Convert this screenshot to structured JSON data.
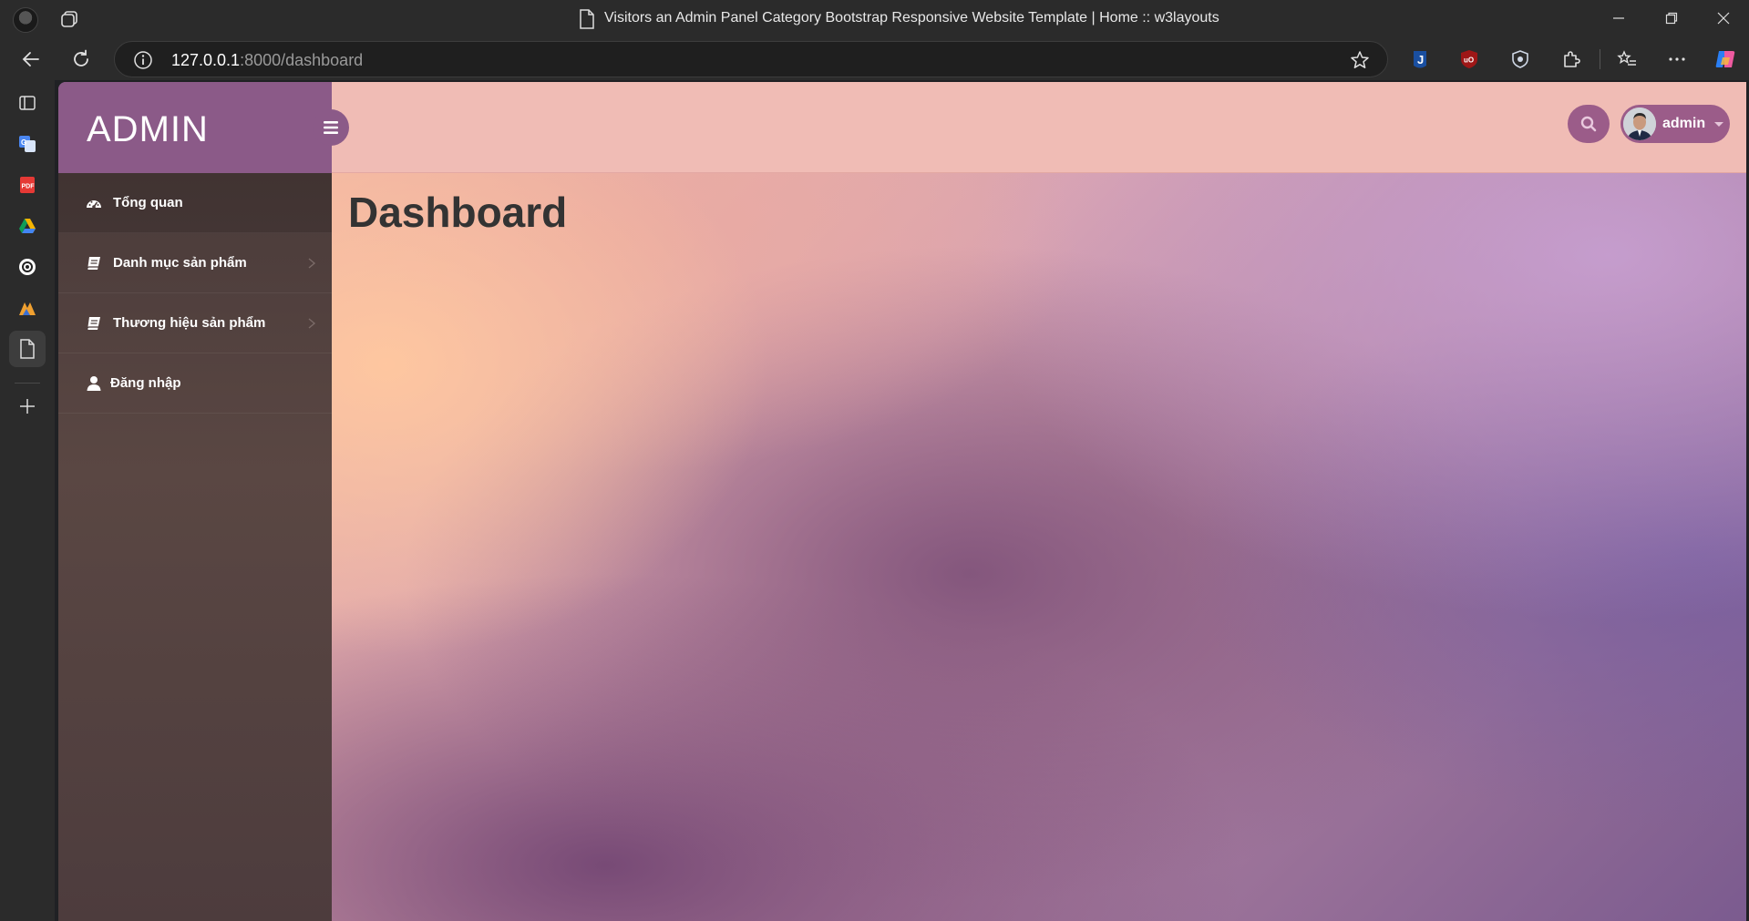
{
  "browser": {
    "window_title": "Visitors an Admin Panel Category Bootstrap Responsive Website Template | Home :: w3layouts",
    "url_host": "127.0.0.1",
    "url_rest": ":8000/dashboard"
  },
  "app": {
    "brand": "ADMIN",
    "user_name": "admin",
    "page_title": "Dashboard"
  },
  "sidebar": {
    "items": [
      {
        "label": "Tổng quan",
        "icon": "dashboard-icon"
      },
      {
        "label": "Danh mục sản phẩm",
        "icon": "book-icon"
      },
      {
        "label": "Thương hiệu sản phẩm",
        "icon": "book-icon"
      },
      {
        "label": "Đăng nhập",
        "icon": "user-icon"
      }
    ]
  },
  "colors": {
    "brand_bg": "#8b5a88",
    "topbar_bg": "#f0bcb5",
    "sidebar_bg": "#4a3b3a",
    "title_text": "#333333"
  }
}
